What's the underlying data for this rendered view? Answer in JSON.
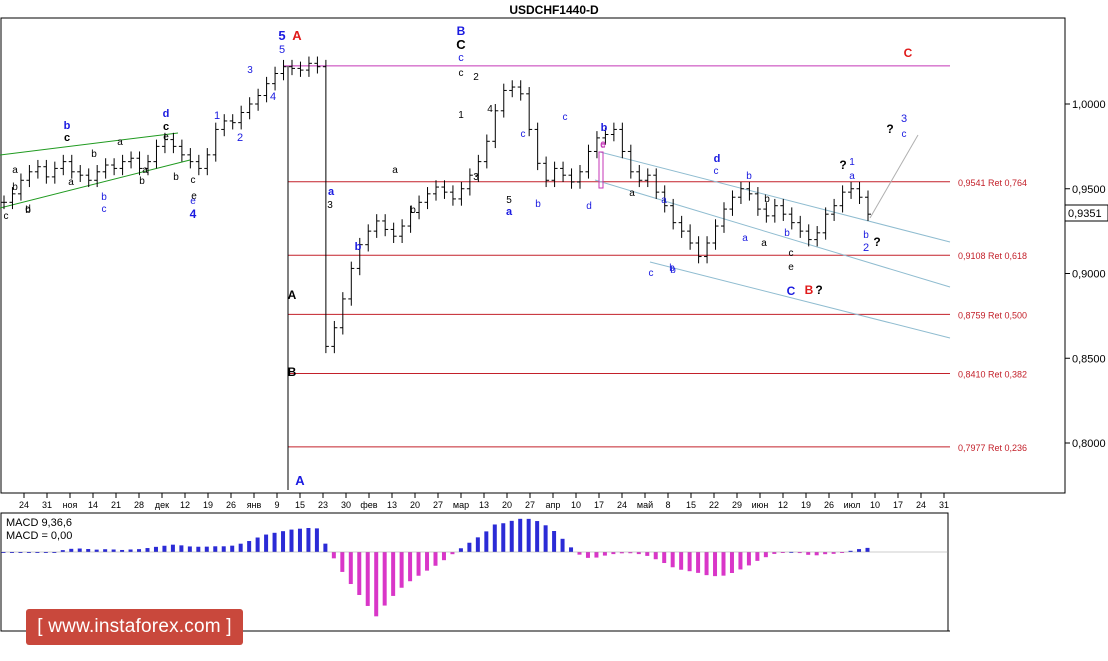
{
  "window": {
    "title": "USDCHF1440-D"
  },
  "watermark": {
    "text": "[ www.instaforex.com ]"
  },
  "current_price": "0,9351",
  "price_axis": [
    "1,0000",
    "0,9500",
    "0,9000",
    "0,8500",
    "0,8000"
  ],
  "fib_levels": [
    {
      "price": 0.9541,
      "label": "0,9541 Ret 0,764"
    },
    {
      "price": 0.9108,
      "label": "0,9108 Ret 0,618"
    },
    {
      "price": 0.8759,
      "label": "0,8759 Ret 0,500"
    },
    {
      "price": 0.841,
      "label": "0,8410 Ret 0,382"
    },
    {
      "price": 0.7977,
      "label": "0,7977 Ret 0,236"
    }
  ],
  "resistance_level": {
    "price": 1.0225
  },
  "date_axis": [
    "24",
    "31",
    "ноя",
    "14",
    "21",
    "28",
    "дек",
    "12",
    "19",
    "26",
    "янв",
    "9",
    "15",
    "23",
    "30",
    "фев",
    "13",
    "20",
    "27",
    "мар",
    "13",
    "20",
    "27",
    "апр",
    "10",
    "17",
    "24",
    "май",
    "8",
    "15",
    "22",
    "29",
    "июн",
    "12",
    "19",
    "26",
    "июл",
    "10",
    "17",
    "24",
    "31"
  ],
  "wave_labels": [
    "5",
    "A",
    "5",
    "B",
    "C",
    "c",
    "c",
    "2",
    "1",
    "3",
    "4",
    "5",
    "a",
    "3",
    "a",
    "b",
    "b",
    "c",
    "b",
    "e",
    "d",
    "b",
    "a",
    "b",
    "c",
    "d",
    "b",
    "a",
    "a",
    "b",
    "a",
    "b",
    "c",
    "e",
    "c",
    "C",
    "B",
    "?",
    "C",
    "?",
    "1",
    "a",
    "3",
    "c",
    "?",
    "b",
    "2",
    "?",
    "A",
    "B",
    "A",
    "3",
    "4",
    "2",
    "1",
    "c",
    "e",
    "4",
    "b",
    "d",
    "e",
    "c",
    "b",
    "a",
    "a",
    "b",
    "b",
    "c",
    "a",
    "b",
    "c",
    "b",
    "a",
    "c",
    "b",
    "d",
    "e",
    "c",
    "a",
    "b",
    "e"
  ],
  "macd": {
    "label": "MACD 9,36,6",
    "value_label": "MACD = 0,00",
    "series_color": "#d936c8",
    "series_color_positive": "#2b2bd6"
  },
  "chart_data": {
    "type": "candlestick",
    "title": "USDCHF1440-D",
    "symbol": "USDCHF",
    "timeframe": "D1",
    "ylim": [
      0.77,
      1.05
    ],
    "grid": false,
    "ohlc_close_path": [
      0.942,
      0.947,
      0.955,
      0.96,
      0.963,
      0.957,
      0.962,
      0.966,
      0.96,
      0.958,
      0.955,
      0.96,
      0.964,
      0.962,
      0.966,
      0.968,
      0.962,
      0.966,
      0.975,
      0.979,
      0.975,
      0.97,
      0.966,
      0.962,
      0.97,
      0.985,
      0.99,
      0.989,
      0.995,
      1.0,
      1.005,
      1.012,
      1.018,
      1.022,
      1.021,
      1.02,
      1.024,
      1.022,
      0.857,
      0.868,
      0.885,
      0.903,
      0.917,
      0.925,
      0.931,
      0.926,
      0.922,
      0.928,
      0.936,
      0.942,
      0.947,
      0.951,
      0.948,
      0.944,
      0.95,
      0.958,
      0.966,
      0.978,
      0.996,
      1.008,
      1.01,
      1.006,
      0.985,
      0.965,
      0.955,
      0.962,
      0.958,
      0.954,
      0.96,
      0.972,
      0.98,
      0.982,
      0.985,
      0.972,
      0.96,
      0.955,
      0.958,
      0.948,
      0.94,
      0.93,
      0.925,
      0.918,
      0.91,
      0.918,
      0.928,
      0.938,
      0.945,
      0.95,
      0.947,
      0.938,
      0.934,
      0.94,
      0.935,
      0.93,
      0.925,
      0.92,
      0.924,
      0.935,
      0.94,
      0.948,
      0.95,
      0.945,
      0.935
    ]
  }
}
